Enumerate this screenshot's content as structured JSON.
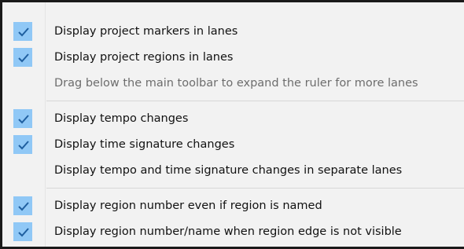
{
  "menu": {
    "items": [
      {
        "label": "Display project markers in lanes",
        "checked": true,
        "enabled": true
      },
      {
        "label": "Display project regions in lanes",
        "checked": true,
        "enabled": true
      },
      {
        "label": "Drag below the main toolbar to expand the ruler for more lanes",
        "checked": false,
        "enabled": false
      },
      {
        "label": "Display tempo changes",
        "checked": true,
        "enabled": true
      },
      {
        "label": "Display time signature changes",
        "checked": true,
        "enabled": true
      },
      {
        "label": "Display tempo and time signature changes in separate lanes",
        "checked": false,
        "enabled": true
      },
      {
        "label": "Display region number even if region is named",
        "checked": true,
        "enabled": true
      },
      {
        "label": "Display region number/name when region edge is not visible",
        "checked": true,
        "enabled": true
      }
    ]
  },
  "colors": {
    "check_highlight": "#90c8f6",
    "check_mark": "#1f5fa0",
    "disabled_text": "#6d6d6d"
  },
  "icons": {
    "checked": "checkmark-icon"
  }
}
